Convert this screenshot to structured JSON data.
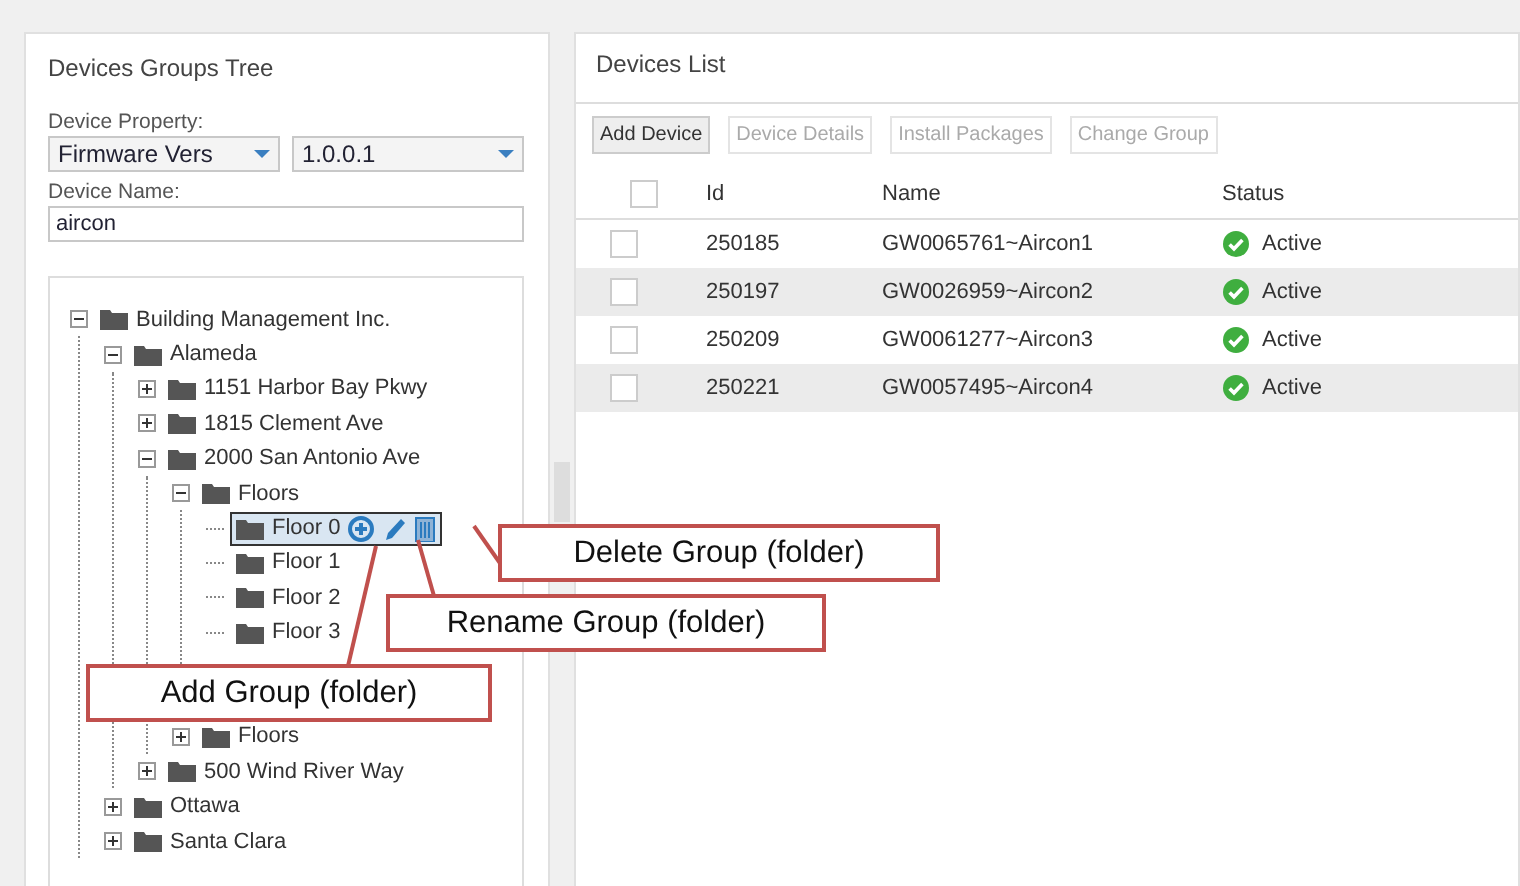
{
  "left_panel": {
    "title": "Devices Groups Tree",
    "property_label": "Device Property:",
    "property_select": "Firmware Vers",
    "value_select": "1.0.0.1",
    "name_label": "Device Name:",
    "name_field": "aircon",
    "tree": [
      {
        "label": "Building Management Inc.",
        "expanded": true,
        "selected": false,
        "children": [
          {
            "label": "Alameda",
            "expanded": true,
            "selected": false,
            "children": [
              {
                "label": "1151 Harbor Bay Pkwy",
                "expanded": false,
                "selected": false
              },
              {
                "label": "1815 Clement Ave",
                "expanded": false,
                "selected": false
              },
              {
                "label": "2000 San Antonio Ave",
                "expanded": true,
                "selected": false,
                "children": [
                  {
                    "label": "Floors",
                    "expanded": true,
                    "selected": false,
                    "children": [
                      {
                        "label": "Floor 0",
                        "selected": true
                      },
                      {
                        "label": "Floor 1",
                        "selected": false
                      },
                      {
                        "label": "Floor 2",
                        "selected": false
                      },
                      {
                        "label": "Floor 3",
                        "selected": false
                      },
                      {
                        "kind": "covered"
                      }
                    ]
                  }
                ]
              },
              {
                "kind": "covered",
                "children": [
                  {
                    "label": "Floors",
                    "expanded": false,
                    "selected": false
                  }
                ]
              },
              {
                "label": "500 Wind River Way",
                "expanded": false,
                "selected": false
              }
            ]
          },
          {
            "label": "Ottawa",
            "expanded": false,
            "selected": false
          },
          {
            "label": "Santa Clara",
            "expanded": false,
            "selected": false
          }
        ]
      }
    ]
  },
  "right_panel": {
    "title": "Devices List",
    "buttons": [
      {
        "label": "Add Device",
        "disabled": false
      },
      {
        "label": "Device Details",
        "disabled": true
      },
      {
        "label": "Install Packages",
        "disabled": true
      },
      {
        "label": "Change Group",
        "disabled": true
      }
    ],
    "columns": [
      "Id",
      "Name",
      "Status"
    ],
    "all_checked": false,
    "rows": [
      {
        "id": "250185",
        "name": "GW0065761~Aircon1",
        "status": "Active",
        "checked": false
      },
      {
        "id": "250197",
        "name": "GW0026959~Aircon2",
        "status": "Active",
        "checked": false
      },
      {
        "id": "250209",
        "name": "GW0061277~Aircon3",
        "status": "Active",
        "checked": false
      },
      {
        "id": "250221",
        "name": "GW0057495~Aircon4",
        "status": "Active",
        "checked": false
      }
    ]
  },
  "callouts": [
    {
      "kind": "delete",
      "text": "Delete Group (folder)"
    },
    {
      "kind": "rename",
      "text": "Rename Group (folder)"
    },
    {
      "kind": "add",
      "text": "Add Group (folder)"
    }
  ]
}
